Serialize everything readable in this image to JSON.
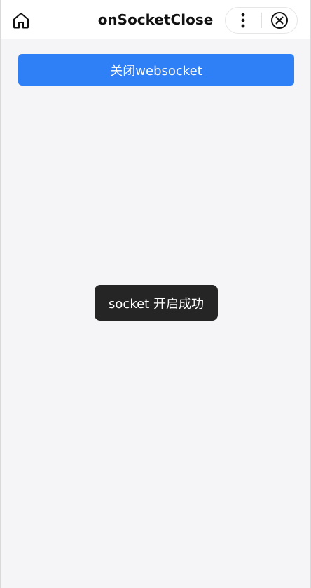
{
  "navbar": {
    "title": "onSocketClose",
    "home_icon": "home-icon",
    "more_icon": "more-dots-icon",
    "close_icon": "close-circle-icon"
  },
  "main": {
    "close_socket_button_label": "关闭websocket"
  },
  "toast": {
    "message": "socket 开启成功"
  },
  "colors": {
    "primary": "#2f7ff6",
    "background": "#f5f4f7",
    "toast_bg": "#252526"
  }
}
